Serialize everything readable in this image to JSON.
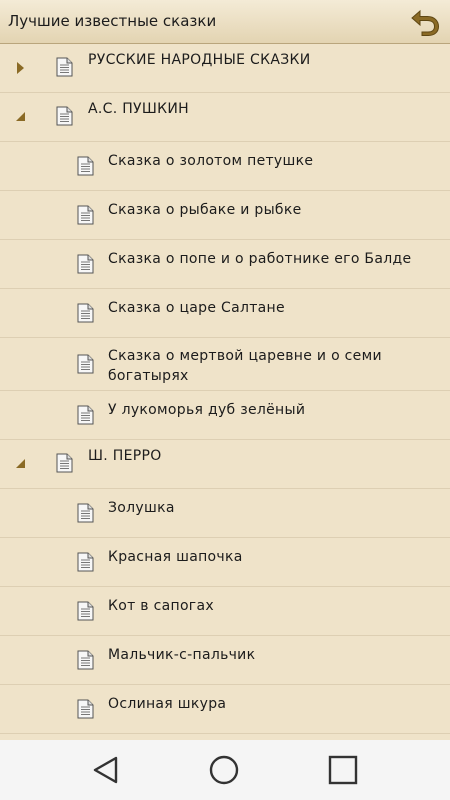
{
  "header": {
    "title": "Лучшие известные сказки",
    "back_icon": "back-arrow-icon",
    "accent": "#8a6a25"
  },
  "sections": [
    {
      "title": "РУССКИЕ НАРОДНЫЕ СКАЗКИ",
      "expanded": false,
      "items": []
    },
    {
      "title": "А.С. ПУШКИН",
      "expanded": true,
      "items": [
        "Сказка о золотом петушке",
        "Сказка о рыбаке и рыбке",
        "Сказка о попе и о работнике его Балде",
        "Сказка о царе Салтане",
        "Сказка о мертвой царевне и о семи богатырях",
        "У лукоморья дуб зелёный"
      ]
    },
    {
      "title": "Ш. ПЕРРО",
      "expanded": true,
      "items": [
        "Золушка",
        "Красная шапочка",
        "Кот в сапогах",
        "Мальчик-с-пальчик",
        "Ослиная шкура"
      ]
    }
  ],
  "navbar": {
    "back_icon": "nav-back-icon",
    "home_icon": "nav-home-icon",
    "recents_icon": "nav-recents-icon"
  }
}
